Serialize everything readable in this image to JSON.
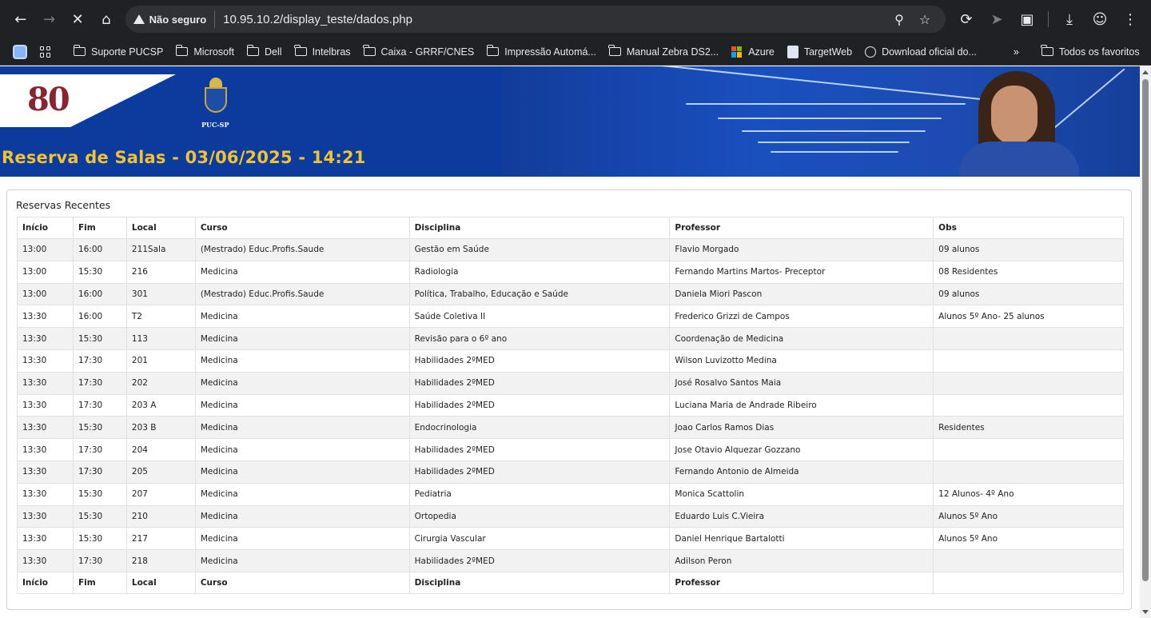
{
  "browser": {
    "security_label": "Não seguro",
    "url": "10.95.10.2/display_teste/dados.php",
    "icons": [
      "back-icon",
      "forward-icon",
      "stop-icon",
      "home-icon",
      "zoom-icon",
      "star-icon",
      "sync-icon",
      "send-icon",
      "extensions-icon",
      "download-icon",
      "profile-icon",
      "menu-icon"
    ]
  },
  "bookmarks": {
    "items": [
      {
        "label": "Suporte PUCSP",
        "icon": "folder-icon"
      },
      {
        "label": "Microsoft",
        "icon": "folder-icon"
      },
      {
        "label": "Dell",
        "icon": "folder-icon"
      },
      {
        "label": "Intelbras",
        "icon": "folder-icon"
      },
      {
        "label": "Caixa - GRRF/CNES",
        "icon": "folder-icon"
      },
      {
        "label": "Impressão Automá...",
        "icon": "folder-icon"
      },
      {
        "label": "Manual Zebra DS2...",
        "icon": "folder-icon"
      },
      {
        "label": "Azure",
        "icon": "microsoft-icon"
      },
      {
        "label": "TargetWeb",
        "icon": "targetweb-icon"
      },
      {
        "label": "Download oficial do...",
        "icon": "globe-icon"
      }
    ],
    "overflow": "»",
    "all_bookmarks": "Todos os favoritos"
  },
  "banner": {
    "title": "Reserva de Salas - 03/06/2025 - 14:21",
    "logo_text": "80",
    "crest_label": "PUC-SP"
  },
  "section": {
    "title": "Reservas Recentes"
  },
  "table": {
    "headers": [
      "Início",
      "Fim",
      "Local",
      "Curso",
      "Disciplina",
      "Professor",
      "Obs"
    ],
    "footer": [
      "Início",
      "Fim",
      "Local",
      "Curso",
      "Disciplina",
      "Professor",
      ""
    ],
    "rows": [
      [
        "13:00",
        "16:00",
        "211Sala",
        "(Mestrado) Educ.Profis.Saude",
        "Gestão em Saúde",
        "Flavio Morgado",
        "09 alunos"
      ],
      [
        "13:00",
        "15:30",
        "216",
        "Medicina",
        "Radiologia",
        "Fernando Martins Martos- Preceptor",
        "08 Residentes"
      ],
      [
        "13:00",
        "16:00",
        "301",
        "(Mestrado) Educ.Profis.Saude",
        "Política, Trabalho, Educação e Saúde",
        "Daniela Miori Pascon",
        "09 alunos"
      ],
      [
        "13:30",
        "16:00",
        "T2",
        "Medicina",
        "Saúde Coletiva II",
        "Frederico Grizzi de Campos",
        "Alunos 5º Ano- 25 alunos"
      ],
      [
        "13:30",
        "15:30",
        "113",
        "Medicina",
        "Revisão para o 6º ano",
        "Coordenação de Medicina",
        ""
      ],
      [
        "13:30",
        "17:30",
        "201",
        "Medicina",
        "Habilidades 2ºMED",
        "Wilson Luvizotto Medina",
        ""
      ],
      [
        "13:30",
        "17:30",
        "202",
        "Medicina",
        "Habilidades 2ºMED",
        "José Rosalvo Santos Maia",
        ""
      ],
      [
        "13:30",
        "17:30",
        "203 A",
        "Medicina",
        "Habilidades 2ºMED",
        "Luciana Maria de Andrade Ribeiro",
        ""
      ],
      [
        "13:30",
        "15:30",
        "203 B",
        "Medicina",
        "Endocrinologia",
        "Joao Carlos Ramos Dias",
        "Residentes"
      ],
      [
        "13:30",
        "17:30",
        "204",
        "Medicina",
        "Habilidades 2ºMED",
        "Jose Otavio Alquezar Gozzano",
        ""
      ],
      [
        "13:30",
        "17:30",
        "205",
        "Medicina",
        "Habilidades 2ºMED",
        "Fernando Antonio de Almeida",
        ""
      ],
      [
        "13:30",
        "15:30",
        "207",
        "Medicina",
        "Pediatria",
        "Monica Scattolin",
        "12 Alunos- 4º Ano"
      ],
      [
        "13:30",
        "15:30",
        "210",
        "Medicina",
        "Ortopedia",
        "Eduardo Luis C.Vieira",
        "Alunos 5º Ano"
      ],
      [
        "13:30",
        "15:30",
        "217",
        "Medicina",
        "Cirurgia Vascular",
        "Daniel Henrique Bartalotti",
        "Alunos 5º Ano"
      ],
      [
        "13:30",
        "17:30",
        "218",
        "Medicina",
        "Habilidades 2ºMED",
        "Adilson Peron",
        ""
      ]
    ]
  }
}
